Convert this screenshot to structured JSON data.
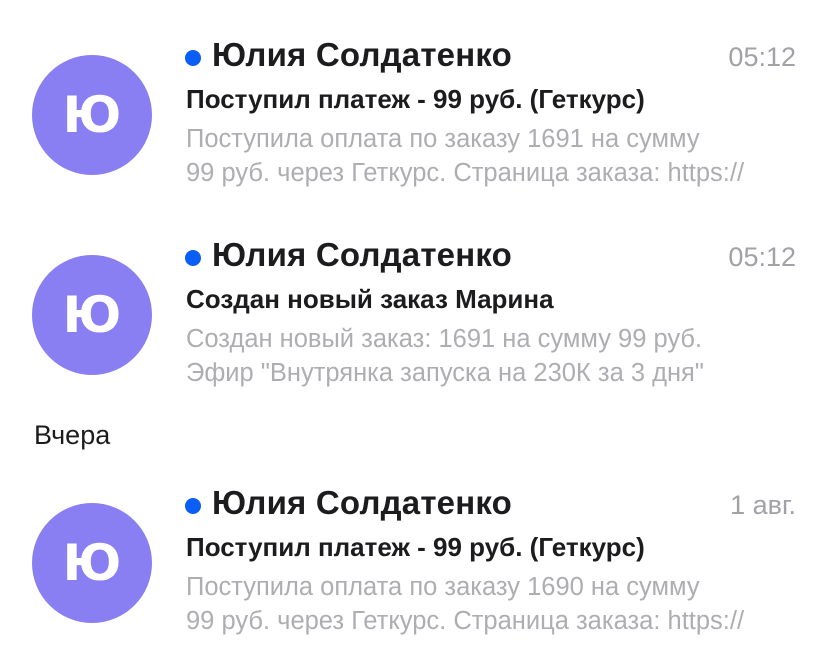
{
  "section_header": "Вчера",
  "colors": {
    "avatar": "#8a7ef3",
    "unread_dot": "#0a5ef5",
    "secondary_text": "#aeaeb2"
  },
  "messages": [
    {
      "avatar_letter": "Ю",
      "sender": "Юлия Солдатенко",
      "time": "05:12",
      "subject": "Поступил платеж - 99 руб. (Геткурс)",
      "preview_line1": "Поступила оплата по заказу 1691 на сумму",
      "preview_line2": "99 руб. через Геткурс. Страница заказа: https://",
      "unread": true
    },
    {
      "avatar_letter": "Ю",
      "sender": "Юлия Солдатенко",
      "time": "05:12",
      "subject": "Создан новый заказ Марина",
      "preview_line1": "Создан новый заказ: 1691 на сумму 99 руб.",
      "preview_line2": "Эфир \"Внутрянка запуска на 230К за 3 дня\"",
      "unread": true
    },
    {
      "avatar_letter": "Ю",
      "sender": "Юлия Солдатенко",
      "time": "1 авг.",
      "subject": "Поступил платеж - 99 руб. (Геткурс)",
      "preview_line1": "Поступила оплата по заказу 1690 на сумму",
      "preview_line2": "99 руб. через Геткурс. Страница заказа: https://",
      "unread": true
    }
  ]
}
